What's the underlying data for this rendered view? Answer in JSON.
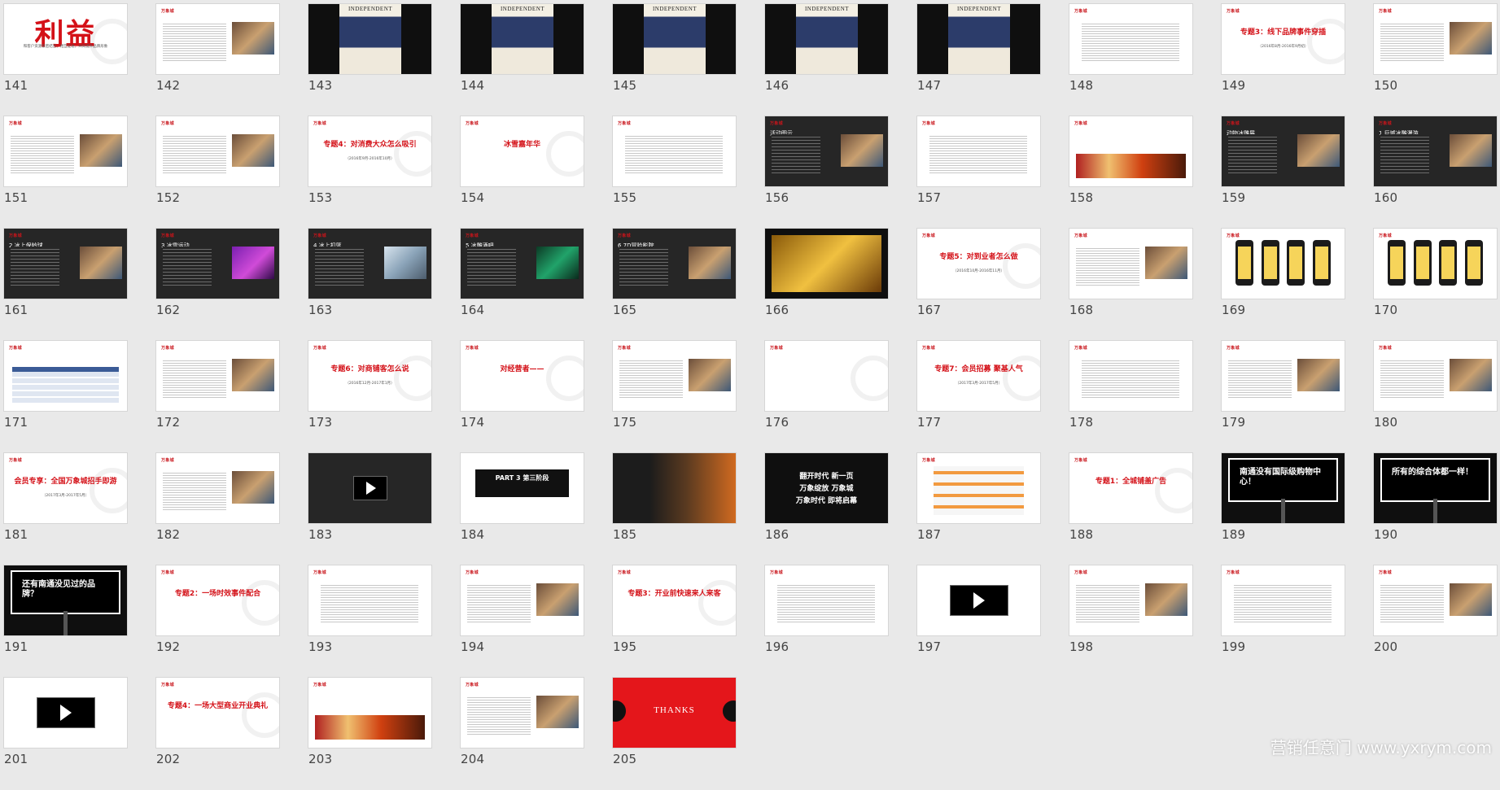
{
  "watermark": "营销任意门 www.yxrym.com",
  "colors": {
    "brand_red": "#d41118",
    "background": "#e9e9e9"
  },
  "logo": "万象城",
  "slides": [
    {
      "n": "141",
      "kind": "big",
      "title": "利益",
      "sub": "和客户资源紧密结合，相互促进，共同提升品牌形象"
    },
    {
      "n": "142",
      "kind": "text-photo",
      "title": "线上活动—如何做？（前文明星推动）"
    },
    {
      "n": "143",
      "kind": "newspaper",
      "head": "INDEPENDENT"
    },
    {
      "n": "144",
      "kind": "newspaper",
      "head": "INDEPENDENT"
    },
    {
      "n": "145",
      "kind": "newspaper",
      "head": "INDEPENDENT"
    },
    {
      "n": "146",
      "kind": "newspaper",
      "head": "INDEPENDENT"
    },
    {
      "n": "147",
      "kind": "newspaper",
      "head": "INDEPENDENT"
    },
    {
      "n": "148",
      "kind": "text",
      "title": ""
    },
    {
      "n": "149",
      "kind": "title",
      "title": "专题3：线下品牌事件穿插",
      "sub": "（2016年8月-2016年9月初）"
    },
    {
      "n": "150",
      "kind": "text-photo",
      "title": ""
    },
    {
      "n": "151",
      "kind": "text-photo",
      "title": ""
    },
    {
      "n": "152",
      "kind": "text-photo",
      "title": ""
    },
    {
      "n": "153",
      "kind": "title",
      "title": "专题4：对消费大众怎么吸引",
      "sub": "（2016年9月-2016年10月）"
    },
    {
      "n": "154",
      "kind": "title",
      "title": "冰雪嘉年华",
      "sub": ""
    },
    {
      "n": "155",
      "kind": "text",
      "title": ""
    },
    {
      "n": "156",
      "kind": "dark-photo",
      "title": "活动图示"
    },
    {
      "n": "157",
      "kind": "text",
      "title": ""
    },
    {
      "n": "158",
      "kind": "text-strip",
      "title": ""
    },
    {
      "n": "159",
      "kind": "dark-photo",
      "title": "动物冰雕展"
    },
    {
      "n": "160",
      "kind": "dark-photo",
      "title": "1.巨城冰雕漫游"
    },
    {
      "n": "161",
      "kind": "dark-photo",
      "title": "2.冰上保龄球"
    },
    {
      "n": "162",
      "kind": "dark-purple",
      "title": "3.冰雪运动"
    },
    {
      "n": "163",
      "kind": "dark-cold",
      "title": "4.冰上扣篮"
    },
    {
      "n": "164",
      "kind": "dark-green",
      "title": "5.冰雕酒吧"
    },
    {
      "n": "165",
      "kind": "dark-photo",
      "title": "6.7D冒险影院"
    },
    {
      "n": "166",
      "kind": "black-collage",
      "title": ""
    },
    {
      "n": "167",
      "kind": "title",
      "title": "专题5：对到业者怎么做",
      "sub": "（2016年10月-2016年11月）"
    },
    {
      "n": "168",
      "kind": "text-photo",
      "title": ""
    },
    {
      "n": "169",
      "kind": "phones",
      "title": ""
    },
    {
      "n": "170",
      "kind": "phones",
      "title": ""
    },
    {
      "n": "171",
      "kind": "table",
      "title": ""
    },
    {
      "n": "172",
      "kind": "text-photo",
      "title": ""
    },
    {
      "n": "173",
      "kind": "title",
      "title": "专题6：对商铺客怎么说",
      "sub": "（2016年12月-2017年1月）"
    },
    {
      "n": "174",
      "kind": "title",
      "title": "对经营者——",
      "sub": ""
    },
    {
      "n": "175",
      "kind": "text-photo",
      "title": ""
    },
    {
      "n": "176",
      "kind": "title-dark",
      "title": "",
      "sub": ""
    },
    {
      "n": "177",
      "kind": "title",
      "title": "专题7：会员招募 聚基人气",
      "sub": "（2017年3月-2017年5月）"
    },
    {
      "n": "178",
      "kind": "text",
      "title": ""
    },
    {
      "n": "179",
      "kind": "text-photo",
      "title": ""
    },
    {
      "n": "180",
      "kind": "text-photo",
      "title": ""
    },
    {
      "n": "181",
      "kind": "title",
      "title": "会员专享：全国万象城招手即游",
      "sub": "（2017年3月-2017年5月）"
    },
    {
      "n": "182",
      "kind": "text-photo",
      "title": ""
    },
    {
      "n": "183",
      "kind": "video-dark",
      "title": ""
    },
    {
      "n": "184",
      "kind": "part",
      "title": "PART 3 第三阶段",
      "sub": ""
    },
    {
      "n": "185",
      "kind": "brand-photo",
      "title": ""
    },
    {
      "n": "186",
      "kind": "black-text",
      "lines": [
        "翻开时代 新一页",
        "万象绽放 万象城",
        "万象时代 即将启幕"
      ]
    },
    {
      "n": "187",
      "kind": "bars",
      "title": ""
    },
    {
      "n": "188",
      "kind": "title",
      "title": "专题1：全城铺盖广告",
      "sub": ""
    },
    {
      "n": "189",
      "kind": "billboard",
      "title": "南通没有国际级购物中心！",
      "sub": ""
    },
    {
      "n": "190",
      "kind": "billboard",
      "title": "所有的综合体都一样！",
      "sub": ""
    },
    {
      "n": "191",
      "kind": "billboard",
      "title": "还有南通没见过的品牌？",
      "sub": ""
    },
    {
      "n": "192",
      "kind": "title",
      "title": "专题2：一场时效事件配合",
      "sub": ""
    },
    {
      "n": "193",
      "kind": "text-center",
      "title": ""
    },
    {
      "n": "194",
      "kind": "text-photo",
      "title": ""
    },
    {
      "n": "195",
      "kind": "title",
      "title": "专题3：开业前快速来人来客",
      "sub": ""
    },
    {
      "n": "196",
      "kind": "text-center",
      "title": ""
    },
    {
      "n": "197",
      "kind": "video",
      "title": ""
    },
    {
      "n": "198",
      "kind": "text-photo",
      "title": ""
    },
    {
      "n": "199",
      "kind": "text-center",
      "title": ""
    },
    {
      "n": "200",
      "kind": "text-photo",
      "title": ""
    },
    {
      "n": "201",
      "kind": "video",
      "title": ""
    },
    {
      "n": "202",
      "kind": "title",
      "title": "专题4：一场大型商业开业典礼",
      "sub": ""
    },
    {
      "n": "203",
      "kind": "text-strip",
      "title": ""
    },
    {
      "n": "204",
      "kind": "text-photo",
      "title": ""
    },
    {
      "n": "205",
      "kind": "thanks",
      "title": "THANKS"
    }
  ]
}
